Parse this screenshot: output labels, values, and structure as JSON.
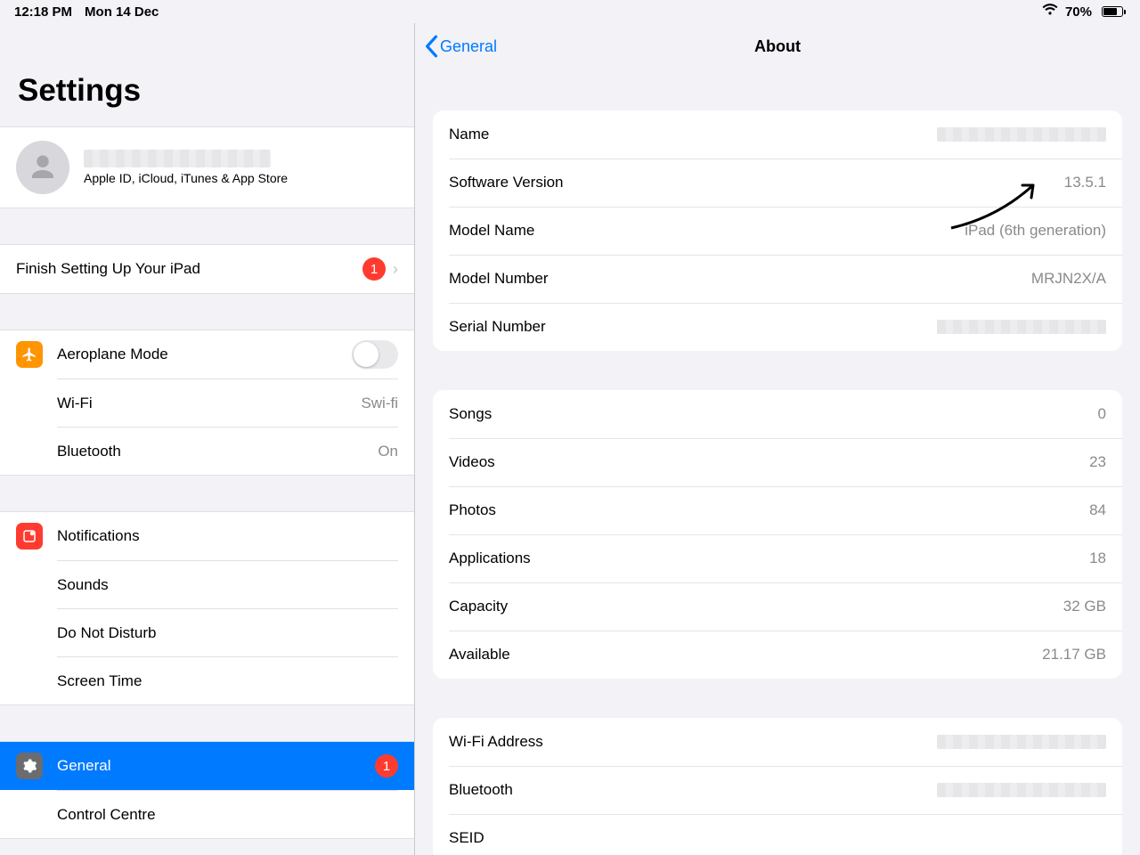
{
  "status": {
    "time": "12:18 PM",
    "date": "Mon 14 Dec",
    "battery_pct": "70%"
  },
  "sidebar": {
    "title": "Settings",
    "account_sub": "Apple ID, iCloud, iTunes & App Store",
    "finish_label": "Finish Setting Up Your iPad",
    "finish_badge": "1",
    "items": {
      "airplane": "Aeroplane Mode",
      "wifi": "Wi-Fi",
      "wifi_value": "Swi-fi",
      "bluetooth": "Bluetooth",
      "bluetooth_value": "On",
      "notifications": "Notifications",
      "sounds": "Sounds",
      "dnd": "Do Not Disturb",
      "screentime": "Screen Time",
      "general": "General",
      "general_badge": "1",
      "control": "Control Centre"
    }
  },
  "detail": {
    "back": "General",
    "title": "About",
    "g1": [
      {
        "label": "Name",
        "value": "",
        "redacted": true
      },
      {
        "label": "Software Version",
        "value": "13.5.1"
      },
      {
        "label": "Model Name",
        "value": "iPad (6th generation)"
      },
      {
        "label": "Model Number",
        "value": "MRJN2X/A"
      },
      {
        "label": "Serial Number",
        "value": "",
        "redacted": true
      }
    ],
    "g2": [
      {
        "label": "Songs",
        "value": "0"
      },
      {
        "label": "Videos",
        "value": "23"
      },
      {
        "label": "Photos",
        "value": "84"
      },
      {
        "label": "Applications",
        "value": "18"
      },
      {
        "label": "Capacity",
        "value": "32 GB"
      },
      {
        "label": "Available",
        "value": "21.17 GB"
      }
    ],
    "g3": [
      {
        "label": "Wi-Fi Address",
        "redacted": true
      },
      {
        "label": "Bluetooth",
        "redacted": true
      },
      {
        "label": "SEID",
        "value": ""
      }
    ]
  }
}
